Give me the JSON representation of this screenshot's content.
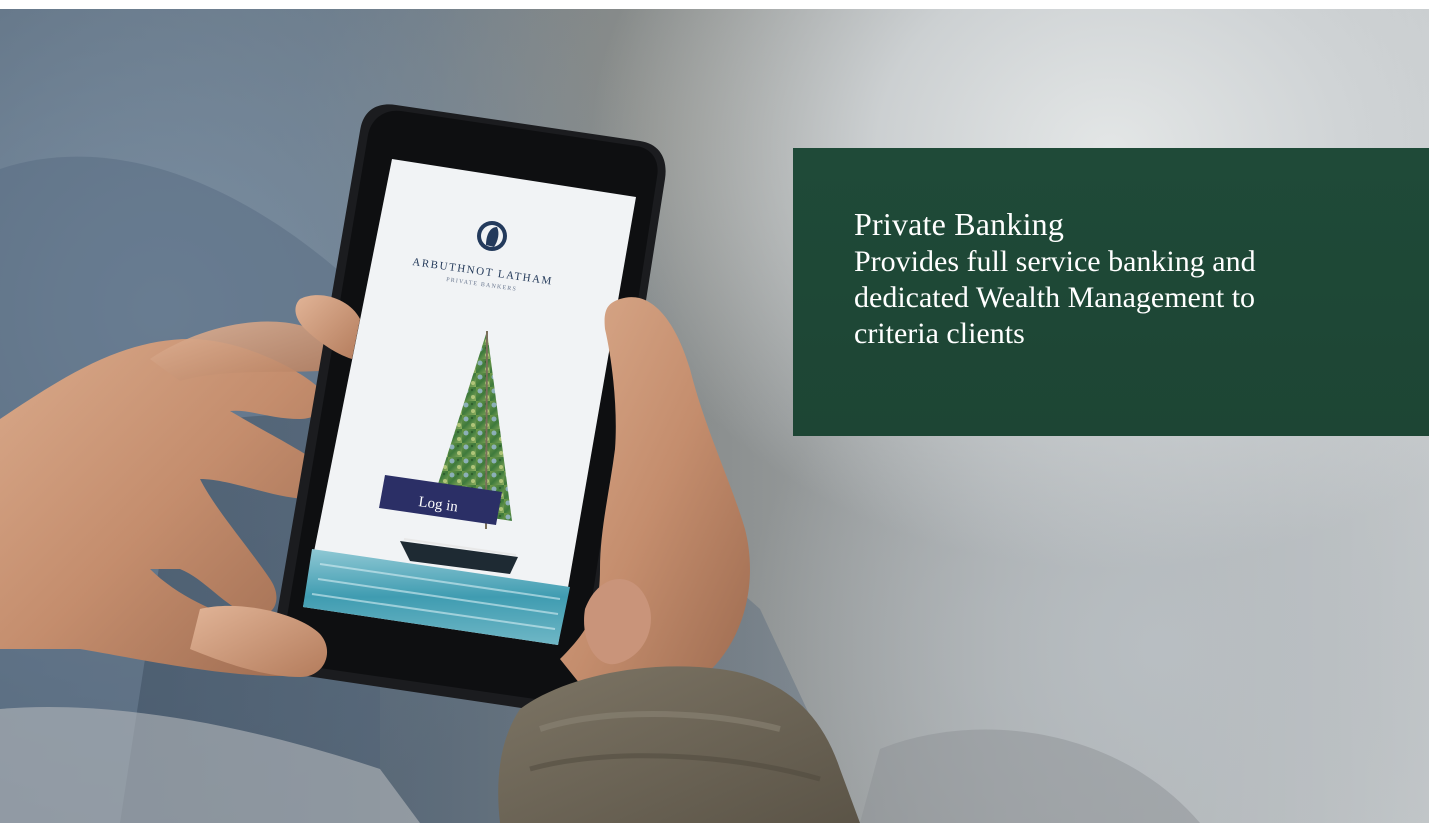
{
  "panel": {
    "title": "Private Banking",
    "body": "Provides full service banking and dedicated Wealth Management to criteria clients"
  },
  "phone": {
    "brand": "ARBUTHNOT LATHAM",
    "subtitle": "PRIVATE BANKERS",
    "login_label": "Log in"
  },
  "colors": {
    "panel_green": "#1f4a38",
    "login_button": "#2b2f66",
    "panel_text": "#ffffff"
  }
}
